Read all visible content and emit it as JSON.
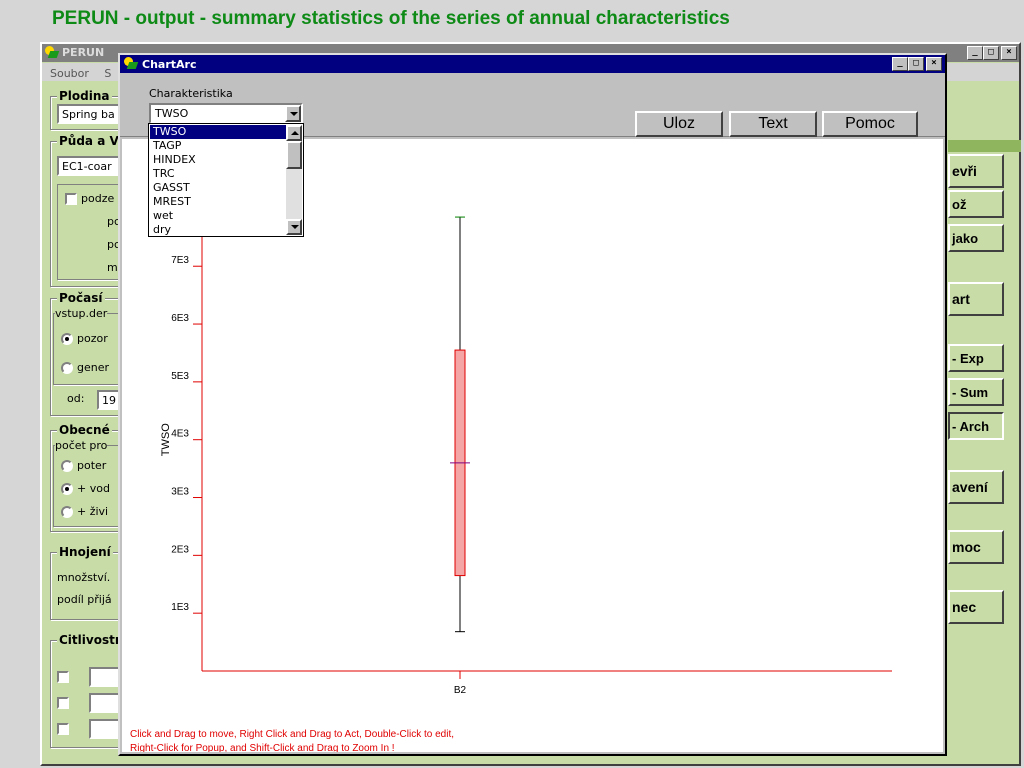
{
  "slide_title": "PERUN - output - summary statistics of the series of annual characteristics",
  "main_window": {
    "title": "PERUN",
    "menu": [
      "Soubor",
      "S"
    ],
    "groups": {
      "plodina": {
        "title": "Plodina",
        "combo_value": "Spring ba"
      },
      "puda": {
        "title": "Půda a V",
        "combo_value": "EC1-coar",
        "checkbox_label": "podze",
        "lines": [
          "pc",
          "pc",
          "m"
        ]
      },
      "pocasi": {
        "title": "Počasí",
        "sub": "vstup.der",
        "radio1": "pozor",
        "radio2": "gener",
        "od_label": "od:",
        "od_value": "19"
      },
      "obecne": {
        "title": "Obecné",
        "sub": "počet pro",
        "radio1": "poter",
        "radio2": "+ vod",
        "radio3": "+ živi"
      },
      "hnojeni": {
        "title": "Hnojení",
        "line1": "množství.",
        "line2": "podíl přijá"
      },
      "citlivost": {
        "title": "Citlivostr"
      }
    },
    "right_buttons": [
      "evři",
      "ož",
      "jako",
      "art",
      "- Exp",
      "- Sum",
      "- Arch",
      "avení",
      "moc",
      "nec"
    ]
  },
  "chart_window": {
    "title": "ChartArc",
    "char_label": "Charakteristika",
    "selected": "TWSO",
    "buttons": {
      "uloz": "Uloz",
      "text": "Text",
      "pomoc": "Pomoc"
    },
    "dropdown_items": [
      "TWSO",
      "TAGP",
      "HINDEX",
      "TRC",
      "GASST",
      "MREST",
      "wet",
      "dry"
    ],
    "hint_lines": [
      "Click and Drag to move, Right Click and Drag to Act, Double-Click to edit,",
      "Right-Click for Popup, and Shift-Click and Drag to Zoom In !"
    ]
  },
  "chart_data": {
    "type": "box",
    "categories": [
      "B2"
    ],
    "ylabel": "TWSO",
    "xlabel": "",
    "yticks": [
      {
        "value": 1000,
        "label": "1E3"
      },
      {
        "value": 2000,
        "label": "2E3"
      },
      {
        "value": 3000,
        "label": "3E3"
      },
      {
        "value": 4000,
        "label": "4E3"
      },
      {
        "value": 5000,
        "label": "5E3"
      },
      {
        "value": 6000,
        "label": "6E3"
      },
      {
        "value": 7000,
        "label": "7E3"
      }
    ],
    "ylim": [
      0,
      9200
    ],
    "boxes": [
      {
        "category": "B2",
        "min": 680,
        "q1": 1650,
        "median": 3600,
        "q3": 5550,
        "max": 7850
      }
    ],
    "colors": {
      "axis": "#e00000",
      "box_fill": "#f4a6a6",
      "max_whisker": "#008000",
      "median": "#800080",
      "whisker": "#000000"
    }
  }
}
